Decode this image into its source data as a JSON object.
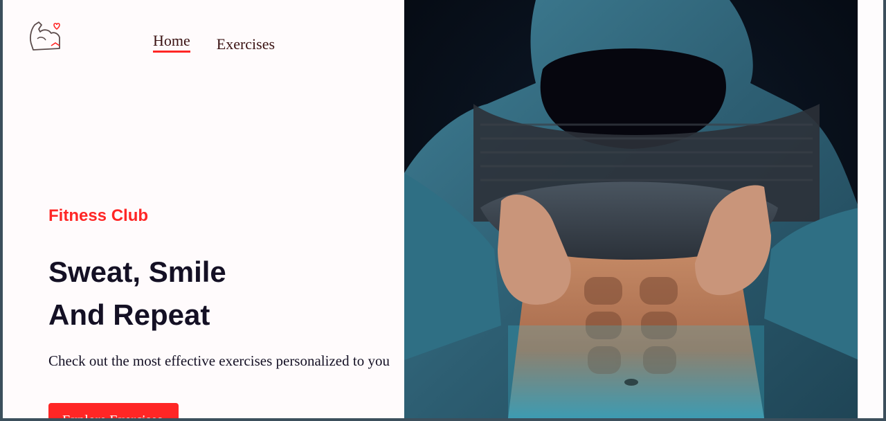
{
  "nav": {
    "items": [
      {
        "label": "Home",
        "active": true
      },
      {
        "label": "Exercises",
        "active": false
      }
    ]
  },
  "logo": {
    "icon": "flexed-arm-heart-icon"
  },
  "hero": {
    "kicker": "Fitness Club",
    "headline": [
      "Sweat, Smile",
      "And Repeat"
    ],
    "subtitle": "Check out the most effective exercises personalized to you",
    "cta_label": "Explore Exercises",
    "image": "hooded-athlete-abs-photo"
  },
  "colors": {
    "accent": "#ff2625",
    "text_dark": "#141024",
    "nav_text": "#3a1212",
    "page_bg": "#fffbfc",
    "frame": "#3c4f5c"
  }
}
